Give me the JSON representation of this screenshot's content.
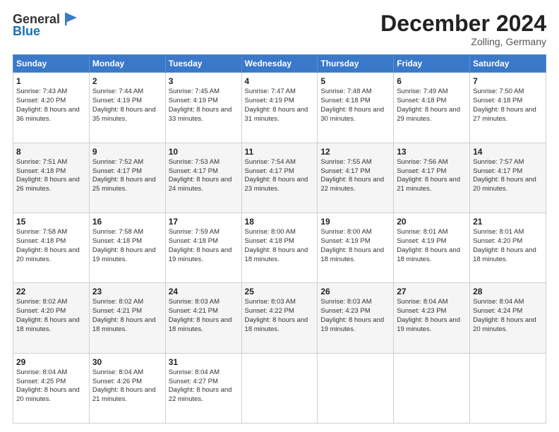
{
  "header": {
    "logo_general": "General",
    "logo_blue": "Blue",
    "month_title": "December 2024",
    "location": "Zolling, Germany"
  },
  "calendar": {
    "days_of_week": [
      "Sunday",
      "Monday",
      "Tuesday",
      "Wednesday",
      "Thursday",
      "Friday",
      "Saturday"
    ],
    "weeks": [
      [
        {
          "day": "1",
          "sunrise": "Sunrise: 7:43 AM",
          "sunset": "Sunset: 4:20 PM",
          "daylight": "Daylight: 8 hours and 36 minutes."
        },
        {
          "day": "2",
          "sunrise": "Sunrise: 7:44 AM",
          "sunset": "Sunset: 4:19 PM",
          "daylight": "Daylight: 8 hours and 35 minutes."
        },
        {
          "day": "3",
          "sunrise": "Sunrise: 7:45 AM",
          "sunset": "Sunset: 4:19 PM",
          "daylight": "Daylight: 8 hours and 33 minutes."
        },
        {
          "day": "4",
          "sunrise": "Sunrise: 7:47 AM",
          "sunset": "Sunset: 4:19 PM",
          "daylight": "Daylight: 8 hours and 31 minutes."
        },
        {
          "day": "5",
          "sunrise": "Sunrise: 7:48 AM",
          "sunset": "Sunset: 4:18 PM",
          "daylight": "Daylight: 8 hours and 30 minutes."
        },
        {
          "day": "6",
          "sunrise": "Sunrise: 7:49 AM",
          "sunset": "Sunset: 4:18 PM",
          "daylight": "Daylight: 8 hours and 29 minutes."
        },
        {
          "day": "7",
          "sunrise": "Sunrise: 7:50 AM",
          "sunset": "Sunset: 4:18 PM",
          "daylight": "Daylight: 8 hours and 27 minutes."
        }
      ],
      [
        {
          "day": "8",
          "sunrise": "Sunrise: 7:51 AM",
          "sunset": "Sunset: 4:18 PM",
          "daylight": "Daylight: 8 hours and 26 minutes."
        },
        {
          "day": "9",
          "sunrise": "Sunrise: 7:52 AM",
          "sunset": "Sunset: 4:17 PM",
          "daylight": "Daylight: 8 hours and 25 minutes."
        },
        {
          "day": "10",
          "sunrise": "Sunrise: 7:53 AM",
          "sunset": "Sunset: 4:17 PM",
          "daylight": "Daylight: 8 hours and 24 minutes."
        },
        {
          "day": "11",
          "sunrise": "Sunrise: 7:54 AM",
          "sunset": "Sunset: 4:17 PM",
          "daylight": "Daylight: 8 hours and 23 minutes."
        },
        {
          "day": "12",
          "sunrise": "Sunrise: 7:55 AM",
          "sunset": "Sunset: 4:17 PM",
          "daylight": "Daylight: 8 hours and 22 minutes."
        },
        {
          "day": "13",
          "sunrise": "Sunrise: 7:56 AM",
          "sunset": "Sunset: 4:17 PM",
          "daylight": "Daylight: 8 hours and 21 minutes."
        },
        {
          "day": "14",
          "sunrise": "Sunrise: 7:57 AM",
          "sunset": "Sunset: 4:17 PM",
          "daylight": "Daylight: 8 hours and 20 minutes."
        }
      ],
      [
        {
          "day": "15",
          "sunrise": "Sunrise: 7:58 AM",
          "sunset": "Sunset: 4:18 PM",
          "daylight": "Daylight: 8 hours and 20 minutes."
        },
        {
          "day": "16",
          "sunrise": "Sunrise: 7:58 AM",
          "sunset": "Sunset: 4:18 PM",
          "daylight": "Daylight: 8 hours and 19 minutes."
        },
        {
          "day": "17",
          "sunrise": "Sunrise: 7:59 AM",
          "sunset": "Sunset: 4:18 PM",
          "daylight": "Daylight: 8 hours and 19 minutes."
        },
        {
          "day": "18",
          "sunrise": "Sunrise: 8:00 AM",
          "sunset": "Sunset: 4:18 PM",
          "daylight": "Daylight: 8 hours and 18 minutes."
        },
        {
          "day": "19",
          "sunrise": "Sunrise: 8:00 AM",
          "sunset": "Sunset: 4:19 PM",
          "daylight": "Daylight: 8 hours and 18 minutes."
        },
        {
          "day": "20",
          "sunrise": "Sunrise: 8:01 AM",
          "sunset": "Sunset: 4:19 PM",
          "daylight": "Daylight: 8 hours and 18 minutes."
        },
        {
          "day": "21",
          "sunrise": "Sunrise: 8:01 AM",
          "sunset": "Sunset: 4:20 PM",
          "daylight": "Daylight: 8 hours and 18 minutes."
        }
      ],
      [
        {
          "day": "22",
          "sunrise": "Sunrise: 8:02 AM",
          "sunset": "Sunset: 4:20 PM",
          "daylight": "Daylight: 8 hours and 18 minutes."
        },
        {
          "day": "23",
          "sunrise": "Sunrise: 8:02 AM",
          "sunset": "Sunset: 4:21 PM",
          "daylight": "Daylight: 8 hours and 18 minutes."
        },
        {
          "day": "24",
          "sunrise": "Sunrise: 8:03 AM",
          "sunset": "Sunset: 4:21 PM",
          "daylight": "Daylight: 8 hours and 18 minutes."
        },
        {
          "day": "25",
          "sunrise": "Sunrise: 8:03 AM",
          "sunset": "Sunset: 4:22 PM",
          "daylight": "Daylight: 8 hours and 18 minutes."
        },
        {
          "day": "26",
          "sunrise": "Sunrise: 8:03 AM",
          "sunset": "Sunset: 4:23 PM",
          "daylight": "Daylight: 8 hours and 19 minutes."
        },
        {
          "day": "27",
          "sunrise": "Sunrise: 8:04 AM",
          "sunset": "Sunset: 4:23 PM",
          "daylight": "Daylight: 8 hours and 19 minutes."
        },
        {
          "day": "28",
          "sunrise": "Sunrise: 8:04 AM",
          "sunset": "Sunset: 4:24 PM",
          "daylight": "Daylight: 8 hours and 20 minutes."
        }
      ],
      [
        {
          "day": "29",
          "sunrise": "Sunrise: 8:04 AM",
          "sunset": "Sunset: 4:25 PM",
          "daylight": "Daylight: 8 hours and 20 minutes."
        },
        {
          "day": "30",
          "sunrise": "Sunrise: 8:04 AM",
          "sunset": "Sunset: 4:26 PM",
          "daylight": "Daylight: 8 hours and 21 minutes."
        },
        {
          "day": "31",
          "sunrise": "Sunrise: 8:04 AM",
          "sunset": "Sunset: 4:27 PM",
          "daylight": "Daylight: 8 hours and 22 minutes."
        },
        null,
        null,
        null,
        null
      ]
    ]
  }
}
